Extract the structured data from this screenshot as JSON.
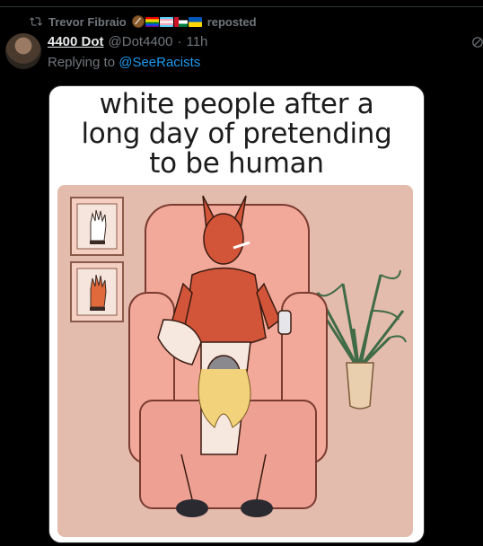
{
  "repost": {
    "user": "Trevor Fibraio",
    "action": "reposted",
    "icon": "repost-icon",
    "emojis": [
      "football-emoji",
      "rainbow-flag",
      "trans-flag",
      "palestine-flag",
      "ukraine-flag"
    ]
  },
  "tweet": {
    "display_name": "4400 Dot",
    "handle": "@Dot4400",
    "separator": "·",
    "time": "11h",
    "reply_prefix": "Replying to",
    "reply_to": "@SeeRacists",
    "more_icon": "more-icon"
  },
  "media": {
    "caption": "white people after a\nlong day of pretending\nto be human"
  },
  "colors": {
    "background": "#000000",
    "text_primary": "#e7e9ea",
    "text_secondary": "#71767b",
    "link": "#1d9bf0",
    "art_background": "#e4bcad",
    "chair": "#f2a99a",
    "figure_red": "#d2553a"
  }
}
